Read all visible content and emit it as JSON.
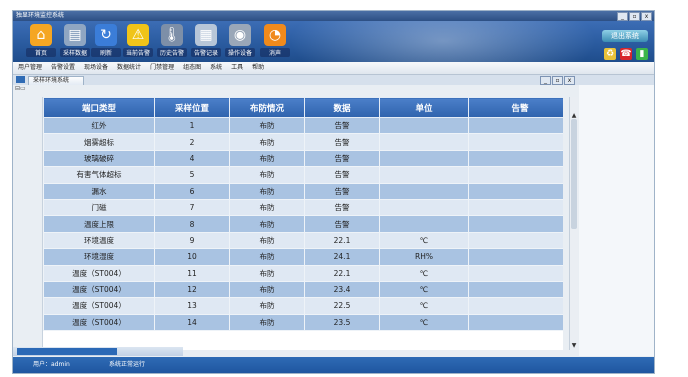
{
  "window": {
    "title": "独显环境监控系统",
    "ctrls": [
      "_",
      "▫",
      "x"
    ]
  },
  "toolbar": [
    {
      "label": "首页",
      "icon": "home-icon",
      "glyph": "⌂",
      "color": "#f5a623"
    },
    {
      "label": "采样数据",
      "icon": "document-icon",
      "glyph": "▤",
      "color": "#8fa6c2"
    },
    {
      "label": "刷新",
      "icon": "refresh-icon",
      "glyph": "↻",
      "color": "#3b7dd8"
    },
    {
      "label": "当前告警",
      "icon": "warning-icon",
      "glyph": "⚠",
      "color": "#f0c419"
    },
    {
      "label": "历史告警",
      "icon": "thermometer-icon",
      "glyph": "🌡",
      "color": "#7d8fa8"
    },
    {
      "label": "告警记录",
      "icon": "calendar-icon",
      "glyph": "▦",
      "color": "#b7c6d8"
    },
    {
      "label": "操作设备",
      "icon": "disk-icon",
      "glyph": "◉",
      "color": "#9aa7b8"
    },
    {
      "label": "消声",
      "icon": "rss-icon",
      "glyph": "◔",
      "color": "#f08a1c"
    }
  ],
  "exit_label": "退出系统",
  "menu": [
    "用户管理",
    "告警设置",
    "现场设备",
    "数据统计",
    "门禁管理",
    "组态图",
    "系统",
    "工具",
    "帮助"
  ],
  "doc_tab": "采样环境系统",
  "inner_ctrls": [
    "_",
    "▫",
    "x"
  ],
  "table": {
    "headers": [
      "端口类型",
      "采样位置",
      "布防情况",
      "数据",
      "单位",
      "告警"
    ],
    "rows": [
      [
        "红外",
        "1",
        "布防",
        "告警",
        "",
        ""
      ],
      [
        "烟雾超标",
        "2",
        "布防",
        "告警",
        "",
        ""
      ],
      [
        "玻璃破碎",
        "4",
        "布防",
        "告警",
        "",
        ""
      ],
      [
        "有害气体超标",
        "5",
        "布防",
        "告警",
        "",
        ""
      ],
      [
        "漏水",
        "6",
        "布防",
        "告警",
        "",
        ""
      ],
      [
        "门磁",
        "7",
        "布防",
        "告警",
        "",
        ""
      ],
      [
        "温度上限",
        "8",
        "布防",
        "告警",
        "",
        ""
      ],
      [
        "环境温度",
        "9",
        "布防",
        "22.1",
        "℃",
        ""
      ],
      [
        "环境湿度",
        "10",
        "布防",
        "24.1",
        "RH%",
        ""
      ],
      [
        "温度（ST004）",
        "11",
        "布防",
        "22.1",
        "℃",
        ""
      ],
      [
        "温度（ST004）",
        "12",
        "布防",
        "23.4",
        "℃",
        ""
      ],
      [
        "温度（ST004）",
        "13",
        "布防",
        "22.5",
        "℃",
        ""
      ],
      [
        "温度（ST004）",
        "14",
        "布防",
        "23.5",
        "℃",
        ""
      ]
    ]
  },
  "status": {
    "user": "用户：admin",
    "state": "系统正常运行"
  }
}
